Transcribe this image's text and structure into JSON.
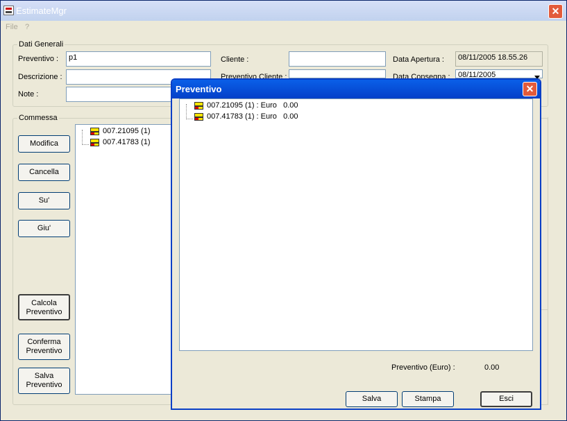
{
  "window": {
    "title": "EstimateMgr"
  },
  "menu": [
    {
      "label": "File"
    },
    {
      "label": "?"
    }
  ],
  "dati_generali": {
    "legend": "Dati Generali",
    "preventivo_label": "Preventivo :",
    "preventivo_value": "p1",
    "descrizione_label": "Descrizione :",
    "note_label": "Note :",
    "cliente_label": "Cliente :",
    "prev_cliente_label": "Preventivo Cliente :",
    "data_apertura_label": "Data Apertura :",
    "data_apertura_value": "08/11/2005 18.55.26",
    "data_consegna_label": "Data Consegna :",
    "data_consegna_value": "08/11/2005"
  },
  "commessa": {
    "legend": "Commessa",
    "buttons": {
      "modifica": "Modifica",
      "cancella": "Cancella",
      "su": "Su'",
      "giu": "Giu'",
      "calcola_1": "Calcola",
      "calcola_2": "Preventivo",
      "conferma_1": "Conferma",
      "conferma_2": "Preventivo",
      "salva_1": "Salva",
      "salva_2": "Preventivo"
    },
    "items": [
      "007.21095 (1)",
      "007.41783 (1)"
    ]
  },
  "dialog": {
    "title": "Preventivo",
    "items": [
      "007.21095 (1) : Euro   0.00",
      "007.41783 (1) : Euro   0.00"
    ],
    "total_label": "Preventivo (Euro) :",
    "total_value": "0.00",
    "buttons": {
      "salva": "Salva",
      "stampa": "Stampa",
      "esci": "Esci"
    }
  },
  "colors": {
    "title_active": "#0a5fe8",
    "close_red": "#e25b3b",
    "face": "#ece9d8"
  }
}
